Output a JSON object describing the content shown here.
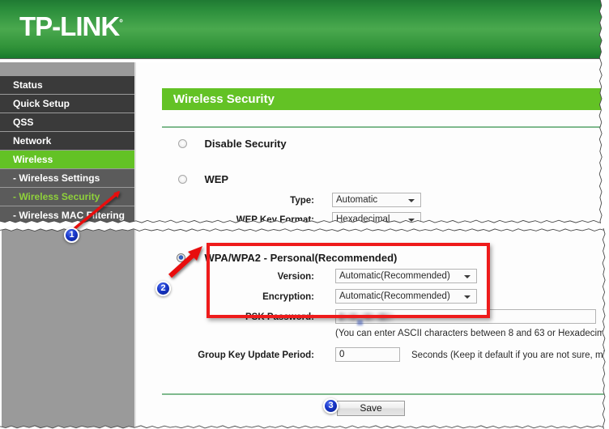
{
  "brand": {
    "name": "TP-LINK",
    "registered_mark": "°"
  },
  "sidebar": {
    "items": [
      {
        "label": "Status",
        "type": "top",
        "state": "normal"
      },
      {
        "label": "Quick Setup",
        "type": "top",
        "state": "normal"
      },
      {
        "label": "QSS",
        "type": "top",
        "state": "normal"
      },
      {
        "label": "Network",
        "type": "top",
        "state": "normal"
      },
      {
        "label": "Wireless",
        "type": "top",
        "state": "active"
      },
      {
        "label": "- Wireless Settings",
        "type": "sub",
        "state": "normal"
      },
      {
        "label": "- Wireless Security",
        "type": "sub",
        "state": "selected"
      },
      {
        "label": "- Wireless MAC Filtering",
        "type": "sub",
        "state": "normal"
      }
    ]
  },
  "page": {
    "title": "Wireless Security"
  },
  "security_options": {
    "disable": {
      "label": "Disable Security",
      "selected": false
    },
    "wep": {
      "label": "WEP",
      "selected": false,
      "type_label": "Type:",
      "type_value": "Automatic",
      "key_format_label": "WEP Key Format:",
      "key_format_value": "Hexadecimal"
    },
    "wpa": {
      "label": "WPA/WPA2 - Personal(Recommended)",
      "selected": true,
      "version_label": "Version:",
      "version_value": "Automatic(Recommended)",
      "encryption_label": "Encryption:",
      "encryption_value": "Automatic(Recommended)",
      "psk_label": "PSK Password:",
      "psk_value": "",
      "psk_hint": "(You can enter ASCII characters between 8 and 63 or Hexadecim",
      "group_key_label": "Group Key Update Period:",
      "group_key_value": "0",
      "group_key_hint": "Seconds (Keep it default if you are not sure, min"
    }
  },
  "actions": {
    "save_label": "Save"
  },
  "callouts": [
    {
      "number": "1"
    },
    {
      "number": "2"
    },
    {
      "number": "3"
    }
  ],
  "colors": {
    "brand_green_dark": "#1f7a33",
    "brand_green_light": "#4aa94e",
    "accent_green": "#63c225",
    "sub_active_text": "#8fd13b",
    "highlight_red": "#ee1b1b",
    "badge_blue": "#1736c8",
    "sidebar_dark": "#3a3a3a",
    "sidebar_sub": "#5b5b5b",
    "sidebar_bg": "#9a9a9a",
    "rule_green": "#7fb98d"
  }
}
